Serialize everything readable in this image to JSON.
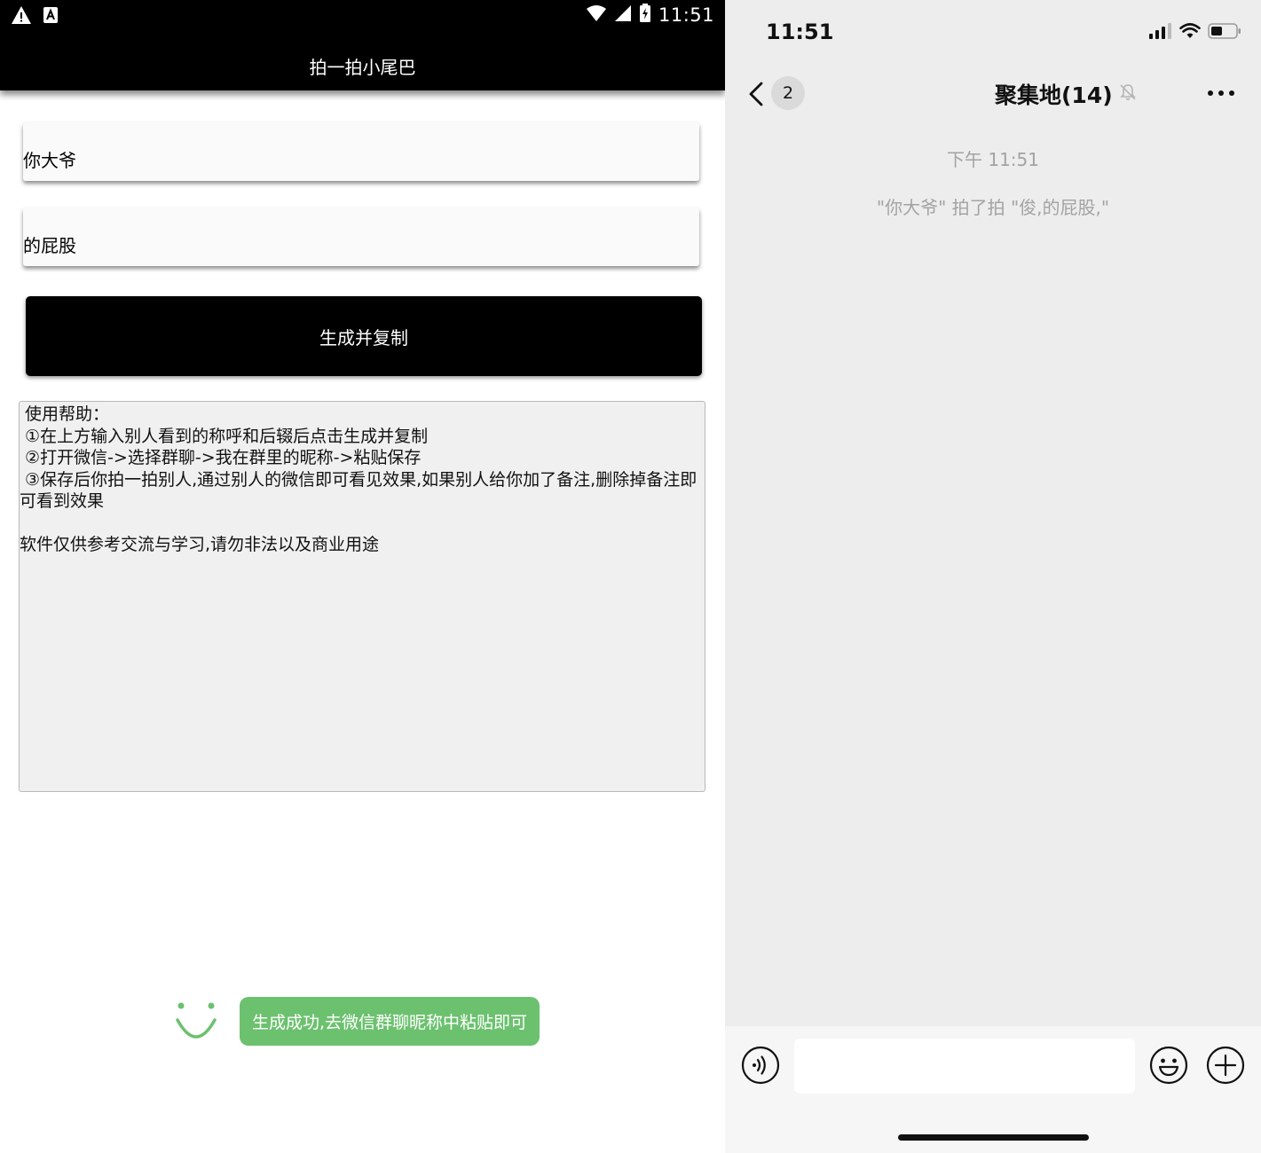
{
  "android": {
    "status_time": "11:51",
    "app_title": "拍一拍小尾巴",
    "name_input": {
      "value": "你大爷"
    },
    "suffix_input": {
      "value": "的屁股"
    },
    "generate_button": "生成并复制",
    "help": {
      "heading": " 使用帮助：",
      "step1": " ①在上方输入别人看到的称呼和后辍后点击生成并复制",
      "step2": " ②打开微信->选择群聊->我在群里的昵称->粘贴保存",
      "step3": " ③保存后你拍一拍别人,通过别人的微信即可看见效果,如果别人给你加了备注,删除掉备注即可看到效果",
      "disclaimer": "软件仅供参考交流与学习,请勿非法以及商业用途"
    },
    "toast": "生成成功,去微信群聊昵称中粘贴即可",
    "colors": {
      "toast_green": "#6cc16f",
      "appbar": "#000000"
    }
  },
  "ios": {
    "status_time": "11:51",
    "back_badge": "2",
    "chat_title": "聚集地(14)",
    "timestamp": "下午 11:51",
    "system_message": "\"你大爷\" 拍了拍 \"俊,的屁股,\"",
    "icons": {
      "signal": "signal-icon",
      "wifi": "wifi-icon",
      "battery": "battery-icon",
      "mute": "mute-bell-icon",
      "voice": "voice-icon",
      "emoji": "emoji-icon",
      "plus": "plus-icon"
    }
  }
}
